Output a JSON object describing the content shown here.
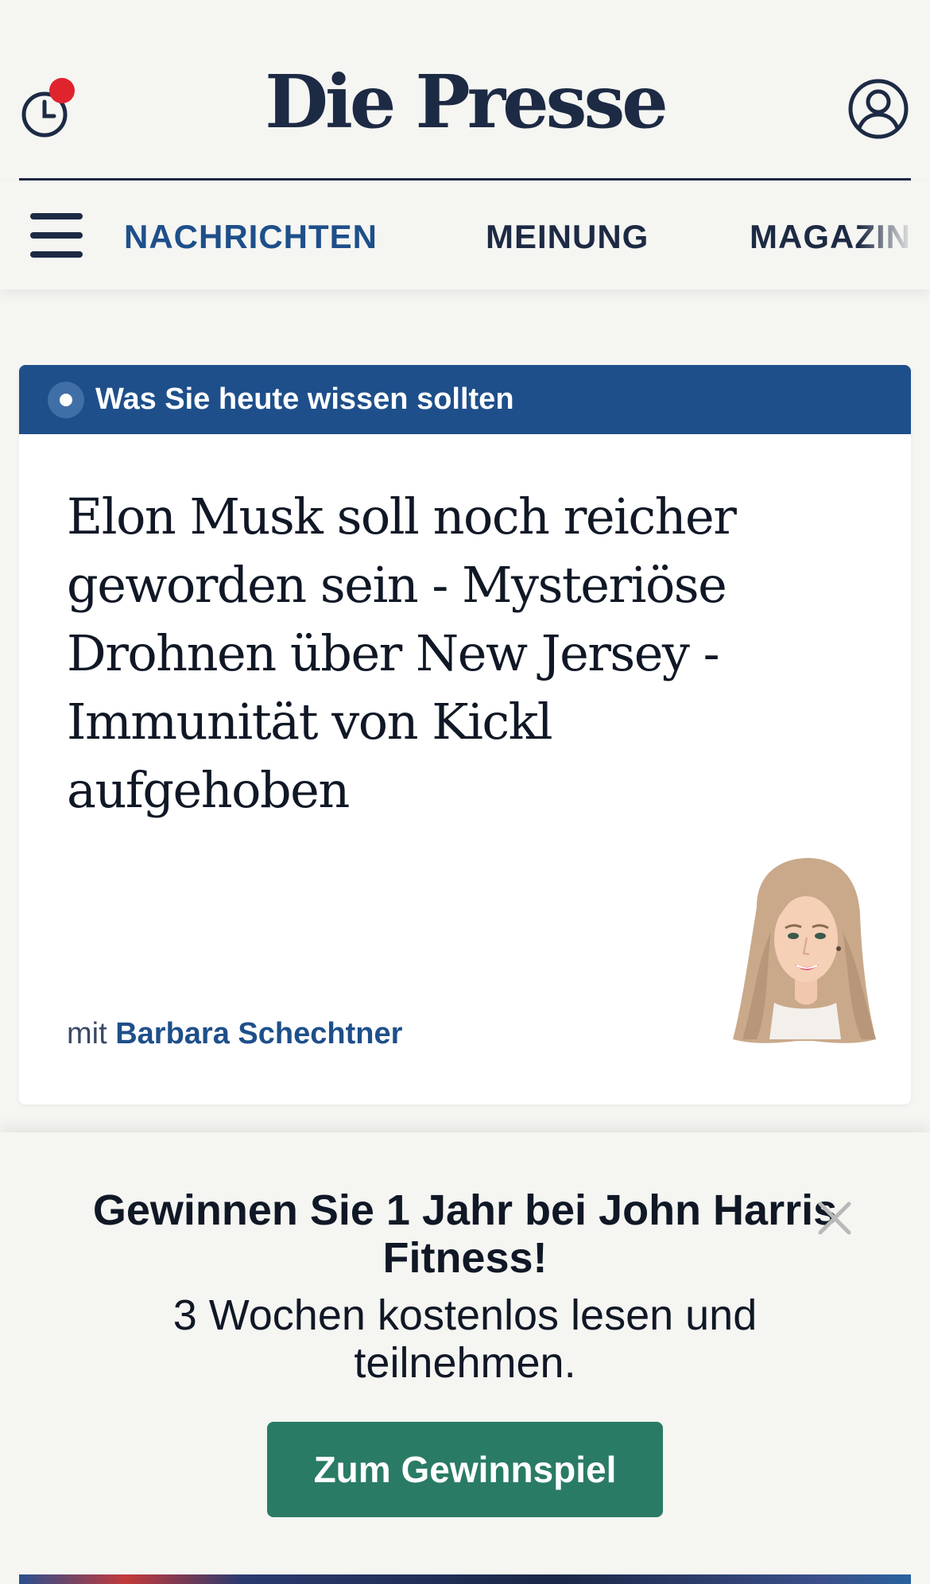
{
  "header": {
    "logo": "Die Presse",
    "history_icon": "clock-icon",
    "history_badge_color": "#e0242e",
    "account_icon": "user-circle-icon"
  },
  "nav": {
    "menu_icon": "hamburger-menu-icon",
    "items": [
      {
        "label": "NACHRICHTEN",
        "active": true
      },
      {
        "label": "MEINUNG",
        "active": false
      },
      {
        "label": "MAGAZIN",
        "active": false
      }
    ]
  },
  "briefing": {
    "banner": "Was Sie heute wissen sollten",
    "headline": "Elon Musk soll noch reicher geworden sein - Mysteriöse Drohnen über New Jersey - Immunität von Kickl aufgehoben",
    "byline_prefix": "mit",
    "author": "Barbara Schechtner",
    "banner_color": "#1e4f8a"
  },
  "promo": {
    "title": "Gewinnen Sie 1 Jahr bei John Harris Fitness!",
    "subtitle": "3 Wochen kostenlos lesen und teilnehmen.",
    "cta": "Zum Gewinnspiel",
    "close_icon": "close-icon",
    "cta_color": "#2a7b66"
  }
}
